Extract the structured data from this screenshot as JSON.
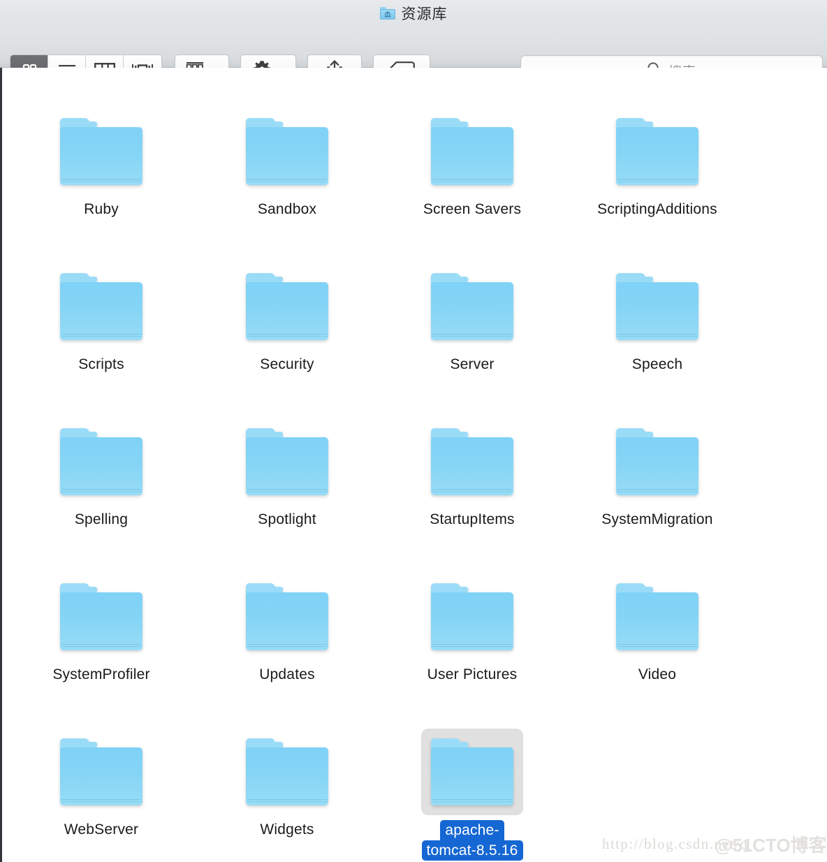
{
  "window": {
    "title": "资源库",
    "title_icon": "folder-library-icon",
    "title_icon_glyph": "\u0001"
  },
  "toolbar": {
    "view_modes": [
      {
        "name": "icon-view",
        "icon": "grid-icon",
        "selected": true
      },
      {
        "name": "list-view",
        "icon": "list-icon",
        "selected": false
      },
      {
        "name": "column-view",
        "icon": "columns-icon",
        "selected": false
      },
      {
        "name": "coverflow-view",
        "icon": "coverflow-icon",
        "selected": false
      }
    ],
    "arrange": {
      "name": "arrange-button",
      "icon": "arrange-grid-icon",
      "chevron": "chevron-down-icon"
    },
    "action": {
      "name": "action-button",
      "icon": "gear-icon",
      "chevron": "chevron-down-icon"
    },
    "share": {
      "name": "share-button",
      "icon": "share-icon"
    },
    "tags": {
      "name": "tags-button",
      "icon": "tag-icon"
    }
  },
  "search": {
    "placeholder": "搜索",
    "value": "",
    "icon": "search-icon"
  },
  "content": {
    "columns": 4,
    "items": [
      {
        "label": "Ruby",
        "selected": false
      },
      {
        "label": "Sandbox",
        "selected": false
      },
      {
        "label": "Screen Savers",
        "selected": false
      },
      {
        "label": "ScriptingAdditions",
        "selected": false
      },
      {
        "label": "Scripts",
        "selected": false
      },
      {
        "label": "Security",
        "selected": false
      },
      {
        "label": "Server",
        "selected": false
      },
      {
        "label": "Speech",
        "selected": false
      },
      {
        "label": "Spelling",
        "selected": false
      },
      {
        "label": "Spotlight",
        "selected": false
      },
      {
        "label": "StartupItems",
        "selected": false
      },
      {
        "label": "SystemMigration",
        "selected": false
      },
      {
        "label": "SystemProfiler",
        "selected": false
      },
      {
        "label": "Updates",
        "selected": false
      },
      {
        "label": "User Pictures",
        "selected": false
      },
      {
        "label": "Video",
        "selected": false
      },
      {
        "label": "WebServer",
        "selected": false
      },
      {
        "label": "Widgets",
        "selected": false
      },
      {
        "label": "apache-tomcat-8.5.16",
        "label_lines": [
          "apache-",
          "tomcat-8.5.16"
        ],
        "selected": true
      }
    ]
  },
  "watermarks": {
    "url": "http://blog.csdn.net/q",
    "brand": "@51CTO博客"
  },
  "colors": {
    "folder_blue": "#84d4f6",
    "folder_tab": "#9adcf8",
    "selection_blue": "#1567d3",
    "selection_gray": "#e0e0e0",
    "toolbar_bg": "#e2e5e8",
    "content_bg": "#ffffff"
  }
}
